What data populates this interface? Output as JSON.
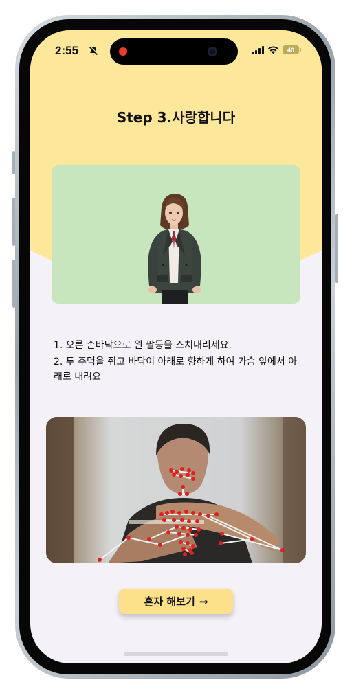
{
  "status_bar": {
    "time": "2:55",
    "silent_icon": "bell-slash-icon",
    "signal_icon": "cellular-signal-icon",
    "wifi_icon": "wifi-icon",
    "battery_level": "40",
    "battery_fraction": 0.4
  },
  "screen": {
    "title": "Step 3.사랑합니다",
    "avatar_alt": "sign-language-avatar",
    "instructions": [
      "1. 오른 손바닥으로 왼 팔등을 스쳐내리세요.",
      "2. 두 주먹을 쥐고 바닥이 아래로 향하게 하여 가슴 앞에서 아래로 내려요"
    ],
    "camera_feed": "hand-tracking-camera-feed",
    "try_button": {
      "label": "혼자 해보기",
      "arrow": "→"
    }
  },
  "colors": {
    "header_yellow": "#fde79b",
    "background": "#f4f2f7",
    "avatar_bg": "#c8e6bd",
    "button_bg": "#fde08a",
    "landmark_red": "#e02020"
  }
}
